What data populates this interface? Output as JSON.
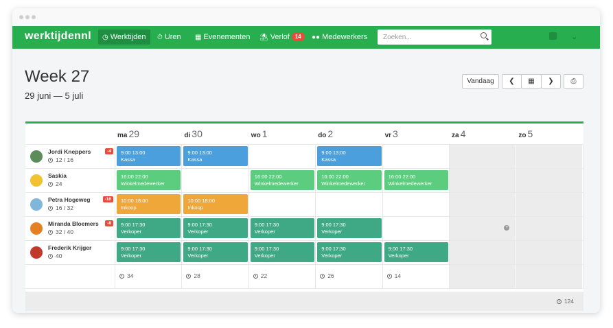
{
  "navbar": {
    "brand": "werktijdennl",
    "items": [
      {
        "label": "Werktijden",
        "icon": "clock-icon",
        "active": true
      },
      {
        "label": "Uren",
        "icon": "stopwatch-icon"
      },
      {
        "label": "Evenementen",
        "icon": "calendar-icon"
      },
      {
        "label": "Verlof",
        "icon": "beach-umbrella-icon",
        "badge": "14"
      },
      {
        "label": "Medewerkers",
        "icon": "users-icon"
      }
    ],
    "search_placeholder": "Zoeken...",
    "color": "#27ae4f"
  },
  "page": {
    "title": "Week 27",
    "range": "29 juni — 5 juli"
  },
  "toolbar": {
    "today_label": "Vandaag"
  },
  "days": [
    {
      "abbr": "ma",
      "num": "29"
    },
    {
      "abbr": "di",
      "num": "30"
    },
    {
      "abbr": "wo",
      "num": "1"
    },
    {
      "abbr": "do",
      "num": "2"
    },
    {
      "abbr": "vr",
      "num": "3"
    },
    {
      "abbr": "za",
      "num": "4"
    },
    {
      "abbr": "zo",
      "num": "5"
    }
  ],
  "employees": [
    {
      "name": "Jordi Kneppers",
      "hours": "12 / 16",
      "badge": "-4",
      "avatar_color": "#5b8c5a",
      "shifts": [
        {
          "day": 0,
          "time": "9:00 13:00",
          "role": "Kassa",
          "color": "#4a9fdc"
        },
        {
          "day": 1,
          "time": "9:00 13:00",
          "role": "Kassa",
          "color": "#4a9fdc"
        },
        {
          "day": 3,
          "time": "9:00 13:00",
          "role": "Kassa",
          "color": "#4a9fdc"
        }
      ]
    },
    {
      "name": "Saskia",
      "hours": "24",
      "badge": "",
      "avatar_color": "#f1c232",
      "shifts": [
        {
          "day": 0,
          "time": "16:00 22:00",
          "role": "Winkelmedewerker",
          "color": "#5ccd7e"
        },
        {
          "day": 2,
          "time": "16:00 22:00",
          "role": "Winkelmedewerker",
          "color": "#5ccd7e"
        },
        {
          "day": 3,
          "time": "16:00 22:00",
          "role": "Winkelmedewerker",
          "color": "#5ccd7e"
        },
        {
          "day": 4,
          "time": "16:00 22:00",
          "role": "Winkelmedewerker",
          "color": "#5ccd7e"
        }
      ]
    },
    {
      "name": "Petra Hogeweg",
      "hours": "16 / 32",
      "badge": "-16",
      "avatar_color": "#7fb6d9",
      "shifts": [
        {
          "day": 0,
          "time": "10:00 18:00",
          "role": "Inkoop",
          "color": "#f0a73a"
        },
        {
          "day": 1,
          "time": "10:00 18:00",
          "role": "Inkoop",
          "color": "#f0a73a"
        }
      ]
    },
    {
      "name": "Miranda Bloemers",
      "hours": "32 / 40",
      "badge": "-8",
      "avatar_color": "#e67e22",
      "shifts": [
        {
          "day": 0,
          "time": "9:00 17:30",
          "role": "Verkoper",
          "color": "#3fa885"
        },
        {
          "day": 1,
          "time": "9:00 17:30",
          "role": "Verkoper",
          "color": "#3fa885"
        },
        {
          "day": 2,
          "time": "9:00 17:30",
          "role": "Verkoper",
          "color": "#3fa885"
        },
        {
          "day": 3,
          "time": "9:00 17:30",
          "role": "Verkoper",
          "color": "#3fa885"
        }
      ]
    },
    {
      "name": "Frederik Krijger",
      "hours": "40",
      "badge": "",
      "avatar_color": "#c0392b",
      "shifts": [
        {
          "day": 0,
          "time": "9:00 17:30",
          "role": "Verkoper",
          "color": "#3fa885"
        },
        {
          "day": 1,
          "time": "9:00 17:30",
          "role": "Verkoper",
          "color": "#3fa885"
        },
        {
          "day": 2,
          "time": "9:00 17:30",
          "role": "Verkoper",
          "color": "#3fa885"
        },
        {
          "day": 3,
          "time": "9:00 17:30",
          "role": "Verkoper",
          "color": "#3fa885"
        },
        {
          "day": 4,
          "time": "9:00 17:30",
          "role": "Verkoper",
          "color": "#3fa885"
        }
      ]
    }
  ],
  "day_totals": [
    "34",
    "28",
    "22",
    "26",
    "14"
  ],
  "grand_total": "124"
}
